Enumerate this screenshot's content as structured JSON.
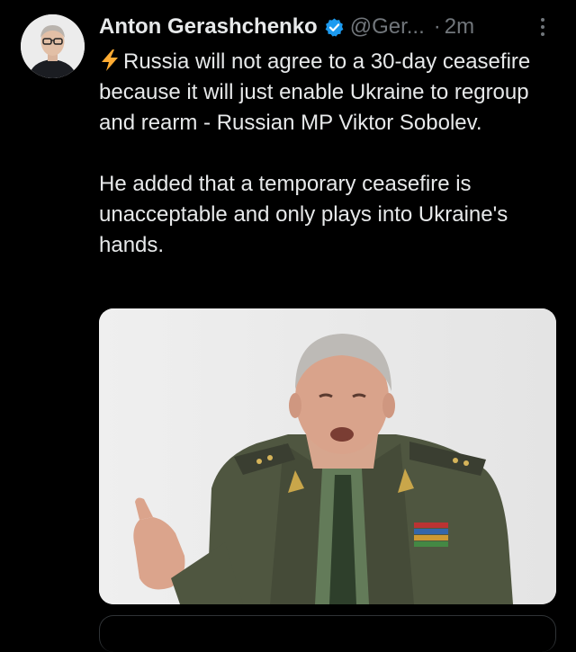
{
  "tweet": {
    "author": {
      "display_name": "Anton Gerashchenko",
      "handle": "@Ger...",
      "verified": true
    },
    "separator": "·",
    "time": "2m",
    "text_line1": "Russia will not agree to a 30-day ceasefire because it will just enable Ukraine to regroup and rearm - Russian MP Viktor Sobolev.",
    "text_line2": "He added that a temporary ceasefire is unacceptable and only plays into Ukraine's hands.",
    "leading_emoji": "high-voltage-icon",
    "media": {
      "type": "photo",
      "subject": "man-in-military-uniform-photo"
    }
  },
  "colors": {
    "background": "#000000",
    "primary_text": "#e7e9ea",
    "secondary_text": "#71767b",
    "verified_blue": "#1d9bf0",
    "bolt_yellow": "#ffac33",
    "border": "#2f3336"
  }
}
